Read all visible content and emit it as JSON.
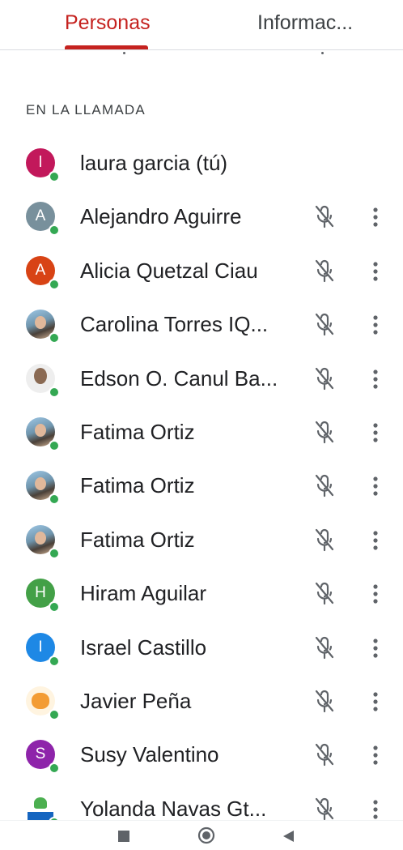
{
  "tabs": {
    "people": "Personas",
    "info": "Informac..."
  },
  "section": {
    "title": "EN LA LLAMADA"
  },
  "colors": {
    "accent": "#c5221f",
    "online": "#34a853",
    "icon": "#5f6368"
  },
  "participants": [
    {
      "name": "laura garcia (tú)",
      "initial": "l",
      "avatar_color": "#c2185b",
      "avatar_type": "initial",
      "muted": false
    },
    {
      "name": "Alejandro Aguirre",
      "initial": "A",
      "avatar_color": "#78909c",
      "avatar_type": "initial",
      "muted": true
    },
    {
      "name": "Alicia Quetzal Ciau",
      "initial": "A",
      "avatar_color": "#d84315",
      "avatar_type": "initial",
      "muted": true
    },
    {
      "name": "Carolina Torres IQ...",
      "initial": "",
      "avatar_color": "",
      "avatar_type": "photo",
      "muted": true
    },
    {
      "name": "Edson O. Canul Ba...",
      "initial": "",
      "avatar_color": "",
      "avatar_type": "face",
      "muted": true
    },
    {
      "name": "Fatima Ortiz",
      "initial": "",
      "avatar_color": "",
      "avatar_type": "photo",
      "muted": true
    },
    {
      "name": "Fatima Ortiz",
      "initial": "",
      "avatar_color": "",
      "avatar_type": "photo",
      "muted": true
    },
    {
      "name": "Fatima Ortiz",
      "initial": "",
      "avatar_color": "",
      "avatar_type": "photo",
      "muted": true
    },
    {
      "name": "Hiram Aguilar",
      "initial": "H",
      "avatar_color": "#43a047",
      "avatar_type": "initial",
      "muted": true
    },
    {
      "name": "Israel Castillo",
      "initial": "I",
      "avatar_color": "#1e88e5",
      "avatar_type": "initial",
      "muted": true
    },
    {
      "name": "Javier Peña",
      "initial": "",
      "avatar_color": "",
      "avatar_type": "fox",
      "muted": true
    },
    {
      "name": "Susy Valentino",
      "initial": "S",
      "avatar_color": "#8e24aa",
      "avatar_type": "initial",
      "muted": true
    },
    {
      "name": "Yolanda Navas Gt...",
      "initial": "",
      "avatar_color": "",
      "avatar_type": "logo",
      "muted": true
    }
  ],
  "icons": {
    "muted": "mic-off-icon",
    "more": "more-vert-icon",
    "nav_recents": "square-icon",
    "nav_home": "circle-icon",
    "nav_back": "triangle-back-icon"
  }
}
